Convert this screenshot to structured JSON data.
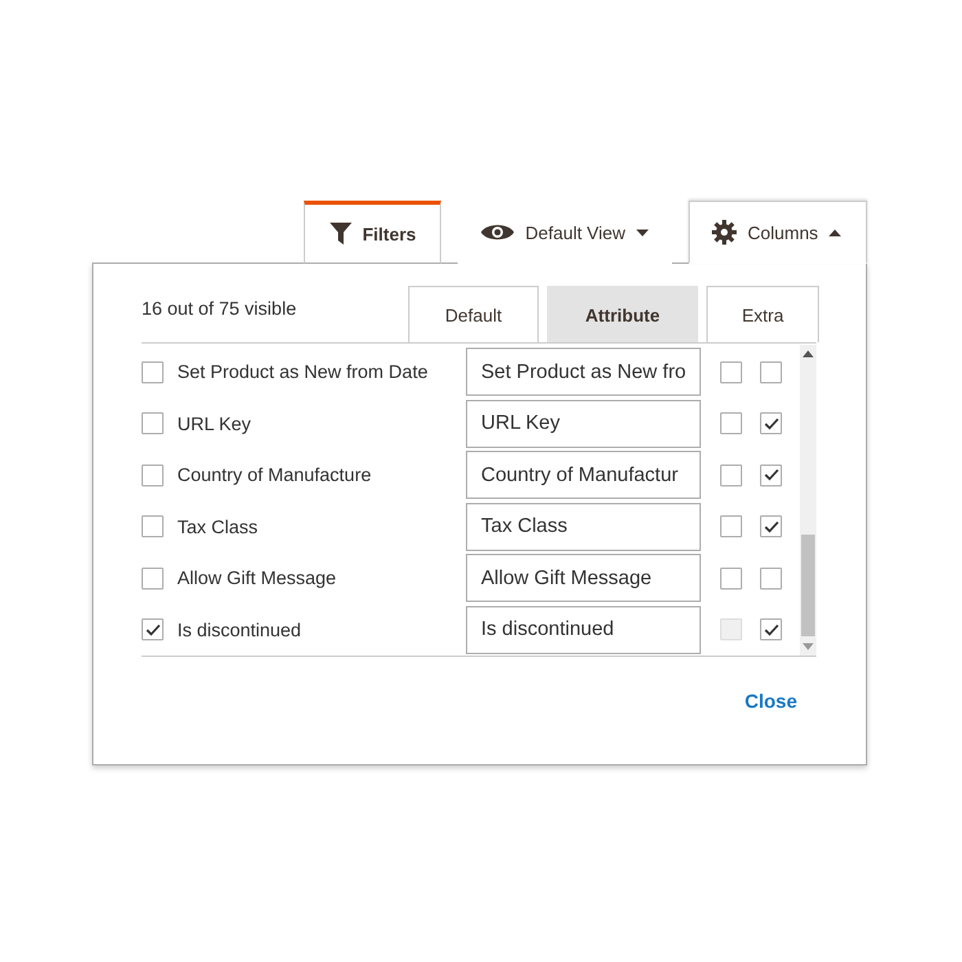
{
  "toolbar": [
    {
      "kind": "filters",
      "label": "Filters",
      "selected": false
    },
    {
      "kind": "view",
      "label": "Default View",
      "selected": false
    },
    {
      "kind": "columns",
      "label": "Columns",
      "selected": true
    }
  ],
  "panel": {
    "count": "16 out of 75 visible",
    "tabs": [
      {
        "label": "Default",
        "selected": false
      },
      {
        "label": "Attribute",
        "selected": true
      },
      {
        "label": "Extra",
        "selected": false
      }
    ],
    "rows": [
      {
        "label": "Set Product as New from Date",
        "visible": false,
        "value": "Set Product as New fro",
        "option_a": {
          "checked": false,
          "disabled": false
        },
        "option_b": {
          "checked": false
        }
      },
      {
        "label": "URL Key",
        "visible": false,
        "value": "URL Key",
        "option_a": {
          "checked": false,
          "disabled": false
        },
        "option_b": {
          "checked": true
        }
      },
      {
        "label": "Country of Manufacture",
        "visible": false,
        "value": "Country of Manufactur",
        "option_a": {
          "checked": false,
          "disabled": false
        },
        "option_b": {
          "checked": true
        }
      },
      {
        "label": "Tax Class",
        "visible": false,
        "value": "Tax Class",
        "option_a": {
          "checked": false,
          "disabled": false
        },
        "option_b": {
          "checked": true
        }
      },
      {
        "label": "Allow Gift Message",
        "visible": false,
        "value": "Allow Gift Message",
        "option_a": {
          "checked": false,
          "disabled": false
        },
        "option_b": {
          "checked": false
        }
      },
      {
        "label": "Is discontinued",
        "visible": true,
        "value": "Is discontinued",
        "option_a": {
          "checked": false,
          "disabled": true
        },
        "option_b": {
          "checked": true
        }
      }
    ],
    "close": "Close"
  }
}
